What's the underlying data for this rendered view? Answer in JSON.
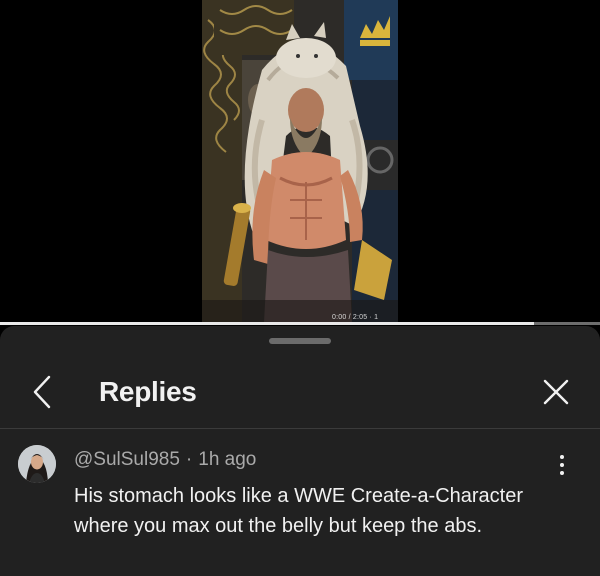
{
  "video": {
    "time_readout": "0:00 / 2:05 · 1",
    "progress": 0.89
  },
  "sheet": {
    "title": "Replies",
    "back_icon": "chevron-left-icon",
    "close_icon": "close-icon"
  },
  "comment": {
    "author": "@SulSul985",
    "separator": "·",
    "timestamp": "1h ago",
    "text": "His stomach looks like a WWE Create-a-Character where you max out the belly but keep the abs.",
    "more_icon": "more-vertical-icon"
  },
  "colors": {
    "sheet_background": "#212121",
    "primary_text": "#f1f1f1",
    "secondary_text": "#aaaaaa",
    "progress_fill": "#e9e9e9",
    "progress_track": "#6d6d6d"
  }
}
